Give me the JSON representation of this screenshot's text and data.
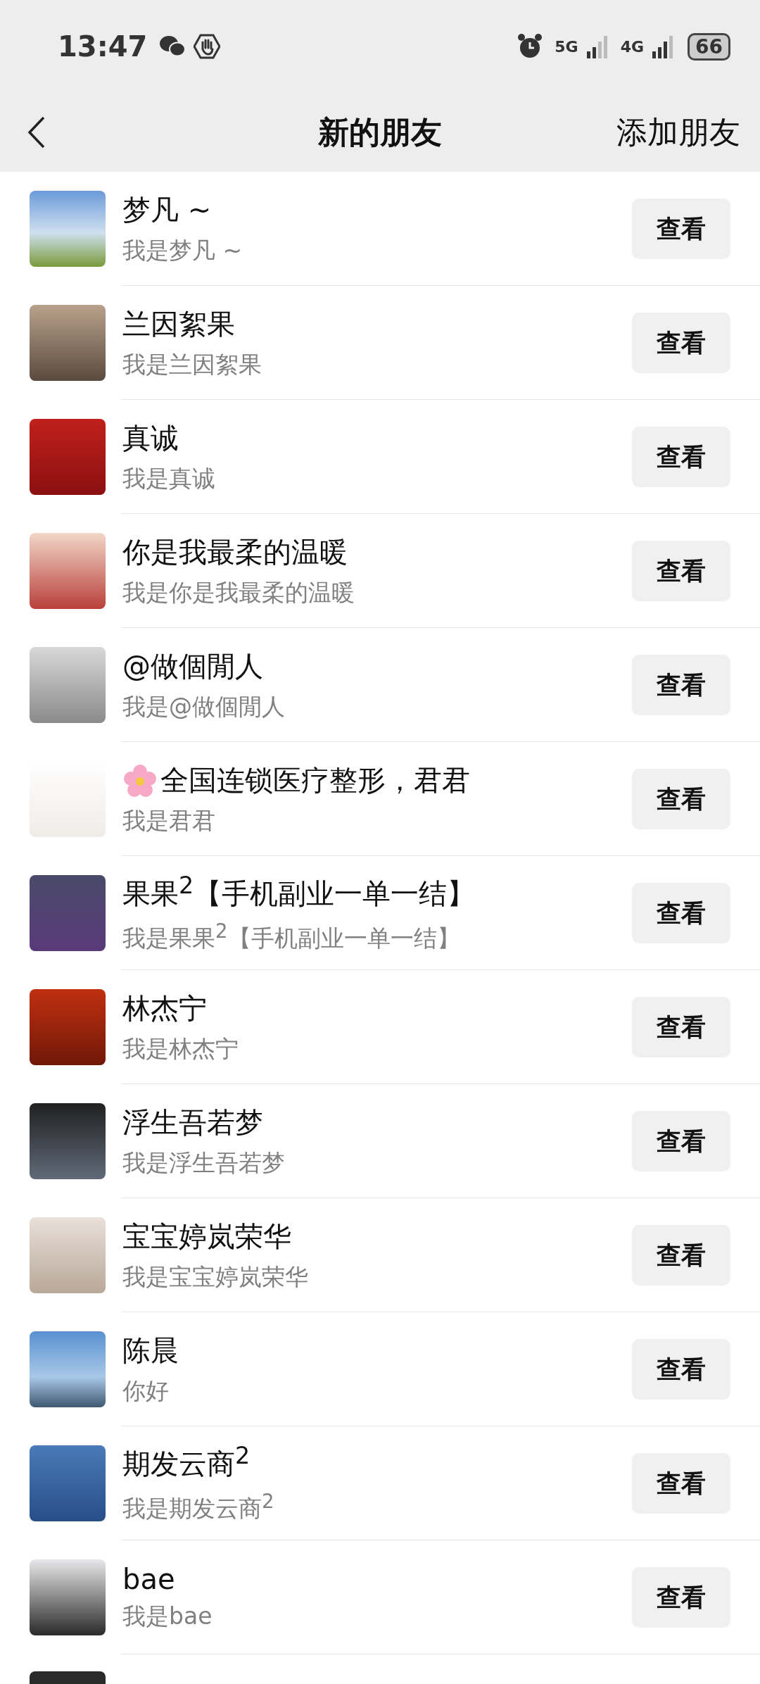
{
  "status_bar": {
    "time": "13:47",
    "network_1": "5G",
    "network_2": "4G",
    "battery": "66"
  },
  "nav_bar": {
    "title": "新的朋友",
    "action": "添加朋友"
  },
  "friends": [
    {
      "name": "梦凡 ~",
      "message": "我是梦凡 ~",
      "button": "查看",
      "emoji": false
    },
    {
      "name": "兰因絮果",
      "message": "我是兰因絮果",
      "button": "查看",
      "emoji": false
    },
    {
      "name": "真诚",
      "message": "我是真诚",
      "button": "查看",
      "emoji": false
    },
    {
      "name": "你是我最柔的温暖",
      "message": "我是你是我最柔的温暖",
      "button": "查看",
      "emoji": false
    },
    {
      "name": "@做個閒人",
      "message": "我是@做個閒人",
      "button": "查看",
      "emoji": false
    },
    {
      "name": "全国连锁医疗整形，君君",
      "message": "我是君君",
      "button": "查看",
      "emoji": true
    },
    {
      "name": "果果$^{2}$【手机副业一单一结】",
      "message": "我是果果$^{2}$【手机副业一单一结】",
      "button": "查看",
      "emoji": false
    },
    {
      "name": "林杰宁",
      "message": "我是林杰宁",
      "button": "查看",
      "emoji": false
    },
    {
      "name": "浮生吾若梦",
      "message": "我是浮生吾若梦",
      "button": "查看",
      "emoji": false
    },
    {
      "name": "宝宝婷岚荣华",
      "message": "我是宝宝婷岚荣华",
      "button": "查看",
      "emoji": false
    },
    {
      "name": "陈晨",
      "message": "你好",
      "button": "查看",
      "emoji": false
    },
    {
      "name": "期发云商$^{2}$",
      "message": "我是期发云商$^{2}$",
      "button": "查看",
      "emoji": false
    },
    {
      "name": "bae",
      "message": "我是bae",
      "button": "查看",
      "emoji": false
    }
  ]
}
